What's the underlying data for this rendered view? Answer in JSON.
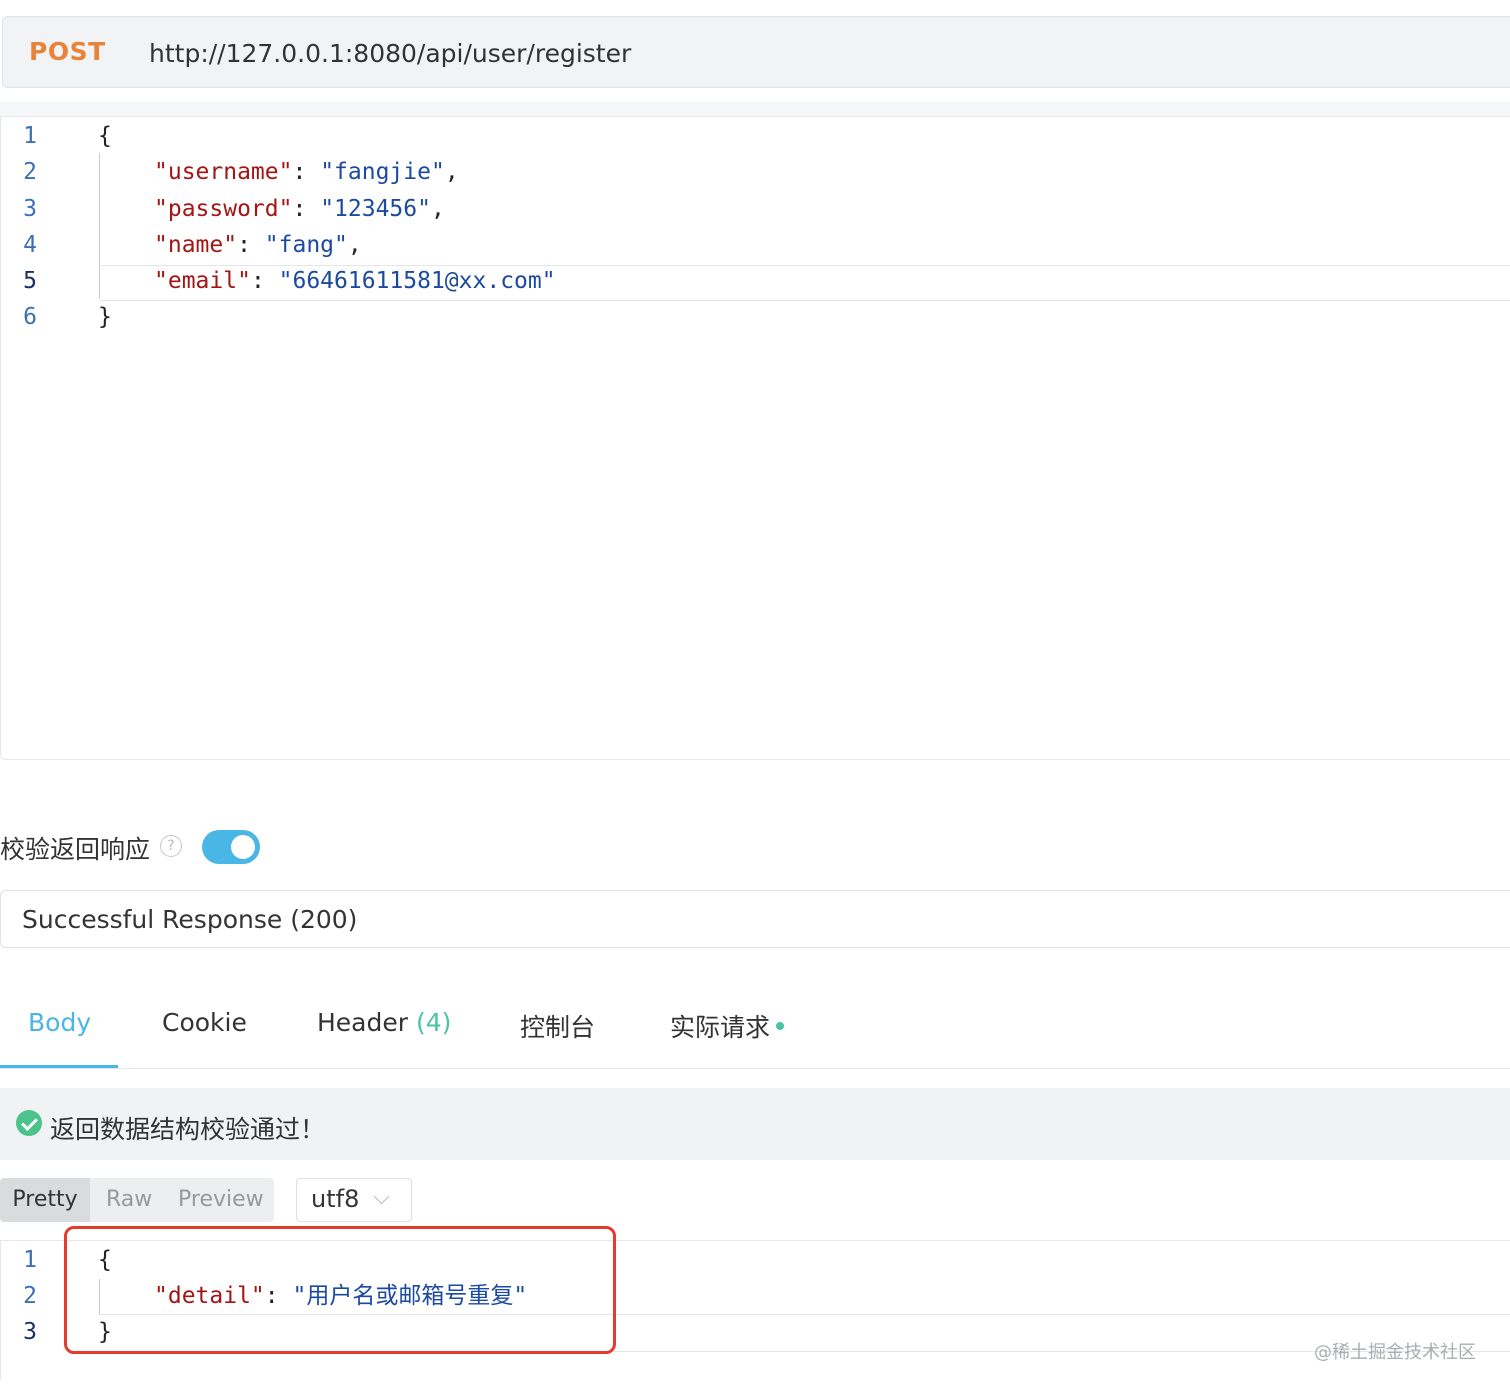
{
  "request": {
    "method": "POST",
    "url": "http://127.0.0.1:8080/api/user/register",
    "body_lines": [
      {
        "num": "1"
      },
      {
        "num": "2",
        "key": "\"username\"",
        "value": "\"fangjie\"",
        "trail": ","
      },
      {
        "num": "3",
        "key": "\"password\"",
        "value": "\"123456\"",
        "trail": ","
      },
      {
        "num": "4",
        "key": "\"name\"",
        "value": "\"fang\"",
        "trail": ","
      },
      {
        "num": "5",
        "key": "\"email\"",
        "value": "\"66461611581@xx.com\"",
        "trail": ""
      },
      {
        "num": "6"
      }
    ],
    "open_brace": "{",
    "close_brace": "}"
  },
  "validation": {
    "label": "校验返回响应",
    "help_icon": "?",
    "enabled": true
  },
  "response_selector": "Successful Response (200)",
  "tabs": [
    {
      "label": "Body",
      "active": true
    },
    {
      "label": "Cookie"
    },
    {
      "label": "Header",
      "count": "(4)"
    },
    {
      "label": "控制台"
    },
    {
      "label": "实际请求",
      "dot": true
    }
  ],
  "pass_message": "返回数据结构校验通过！",
  "view_modes": [
    "Pretty",
    "Raw",
    "Preview"
  ],
  "active_view": "Pretty",
  "encoding": "utf8",
  "response": {
    "line_numbers": [
      "1",
      "2",
      "3"
    ],
    "open_brace": "{",
    "key": "\"detail\"",
    "value": "\"用户名或邮箱号重复\"",
    "close_brace": "}"
  },
  "watermark": "@稀土掘金技术社区",
  "colors": {
    "accent": "#4ab6e6",
    "method": "#e8833a",
    "highlight_box": "#e53b2c",
    "success": "#4cc38a"
  }
}
